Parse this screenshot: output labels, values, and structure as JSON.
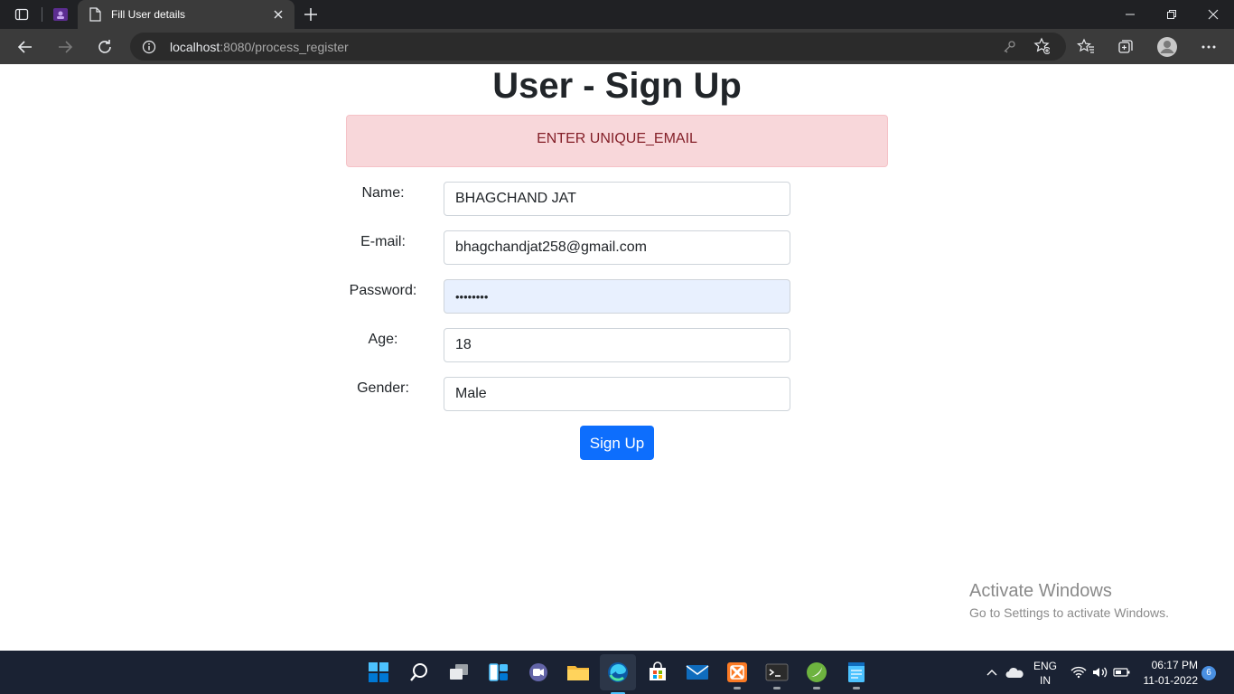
{
  "browser": {
    "tab_title": "Fill User details",
    "address_host": "localhost",
    "address_rest": ":8080/process_register"
  },
  "page": {
    "heading": "User - Sign Up",
    "alert": "ENTER UNIQUE_EMAIL",
    "form": {
      "name_label": "Name:",
      "name_value": "BHAGCHAND JAT",
      "email_label": "E-mail:",
      "email_value": "bhagchandjat258@gmail.com",
      "password_label": "Password:",
      "password_value": "••••••••",
      "age_label": "Age:",
      "age_value": "18",
      "gender_label": "Gender:",
      "gender_value": "Male",
      "submit_label": "Sign Up"
    },
    "watermark": {
      "line1": "Activate Windows",
      "line2": "Go to Settings to activate Windows."
    }
  },
  "taskbar": {
    "language": "ENG",
    "region": "IN",
    "time": "06:17 PM",
    "date": "11-01-2022",
    "notifications": "6"
  },
  "colors": {
    "alert_bg": "#f8d7da",
    "alert_text": "#842029",
    "primary": "#0d6efd",
    "autofill": "#e8f0fe"
  }
}
